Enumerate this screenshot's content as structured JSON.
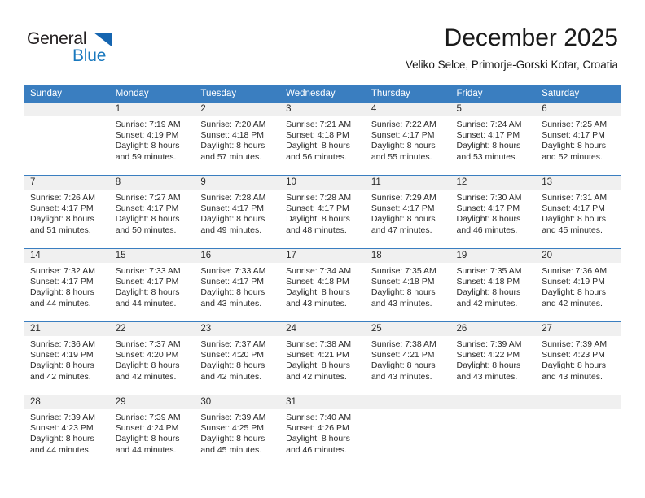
{
  "brand": {
    "name_top": "General",
    "name_bottom": "Blue",
    "accent_color": "#1878be",
    "triangle_color": "#1565b0"
  },
  "header": {
    "title": "December 2025",
    "subtitle": "Veliko Selce, Primorje-Gorski Kotar, Croatia"
  },
  "theme": {
    "header_row_bg": "#3a7ec0",
    "daynum_bg": "#f0f0f0",
    "text_color": "#2b2b2b"
  },
  "weekdays": [
    "Sunday",
    "Monday",
    "Tuesday",
    "Wednesday",
    "Thursday",
    "Friday",
    "Saturday"
  ],
  "weeks": [
    [
      {
        "day": "",
        "sunrise": "",
        "sunset": "",
        "daylight_l1": "",
        "daylight_l2": "",
        "empty": true
      },
      {
        "day": "1",
        "sunrise": "Sunrise: 7:19 AM",
        "sunset": "Sunset: 4:19 PM",
        "daylight_l1": "Daylight: 8 hours",
        "daylight_l2": "and 59 minutes."
      },
      {
        "day": "2",
        "sunrise": "Sunrise: 7:20 AM",
        "sunset": "Sunset: 4:18 PM",
        "daylight_l1": "Daylight: 8 hours",
        "daylight_l2": "and 57 minutes."
      },
      {
        "day": "3",
        "sunrise": "Sunrise: 7:21 AM",
        "sunset": "Sunset: 4:18 PM",
        "daylight_l1": "Daylight: 8 hours",
        "daylight_l2": "and 56 minutes."
      },
      {
        "day": "4",
        "sunrise": "Sunrise: 7:22 AM",
        "sunset": "Sunset: 4:17 PM",
        "daylight_l1": "Daylight: 8 hours",
        "daylight_l2": "and 55 minutes."
      },
      {
        "day": "5",
        "sunrise": "Sunrise: 7:24 AM",
        "sunset": "Sunset: 4:17 PM",
        "daylight_l1": "Daylight: 8 hours",
        "daylight_l2": "and 53 minutes."
      },
      {
        "day": "6",
        "sunrise": "Sunrise: 7:25 AM",
        "sunset": "Sunset: 4:17 PM",
        "daylight_l1": "Daylight: 8 hours",
        "daylight_l2": "and 52 minutes."
      }
    ],
    [
      {
        "day": "7",
        "sunrise": "Sunrise: 7:26 AM",
        "sunset": "Sunset: 4:17 PM",
        "daylight_l1": "Daylight: 8 hours",
        "daylight_l2": "and 51 minutes."
      },
      {
        "day": "8",
        "sunrise": "Sunrise: 7:27 AM",
        "sunset": "Sunset: 4:17 PM",
        "daylight_l1": "Daylight: 8 hours",
        "daylight_l2": "and 50 minutes."
      },
      {
        "day": "9",
        "sunrise": "Sunrise: 7:28 AM",
        "sunset": "Sunset: 4:17 PM",
        "daylight_l1": "Daylight: 8 hours",
        "daylight_l2": "and 49 minutes."
      },
      {
        "day": "10",
        "sunrise": "Sunrise: 7:28 AM",
        "sunset": "Sunset: 4:17 PM",
        "daylight_l1": "Daylight: 8 hours",
        "daylight_l2": "and 48 minutes."
      },
      {
        "day": "11",
        "sunrise": "Sunrise: 7:29 AM",
        "sunset": "Sunset: 4:17 PM",
        "daylight_l1": "Daylight: 8 hours",
        "daylight_l2": "and 47 minutes."
      },
      {
        "day": "12",
        "sunrise": "Sunrise: 7:30 AM",
        "sunset": "Sunset: 4:17 PM",
        "daylight_l1": "Daylight: 8 hours",
        "daylight_l2": "and 46 minutes."
      },
      {
        "day": "13",
        "sunrise": "Sunrise: 7:31 AM",
        "sunset": "Sunset: 4:17 PM",
        "daylight_l1": "Daylight: 8 hours",
        "daylight_l2": "and 45 minutes."
      }
    ],
    [
      {
        "day": "14",
        "sunrise": "Sunrise: 7:32 AM",
        "sunset": "Sunset: 4:17 PM",
        "daylight_l1": "Daylight: 8 hours",
        "daylight_l2": "and 44 minutes."
      },
      {
        "day": "15",
        "sunrise": "Sunrise: 7:33 AM",
        "sunset": "Sunset: 4:17 PM",
        "daylight_l1": "Daylight: 8 hours",
        "daylight_l2": "and 44 minutes."
      },
      {
        "day": "16",
        "sunrise": "Sunrise: 7:33 AM",
        "sunset": "Sunset: 4:17 PM",
        "daylight_l1": "Daylight: 8 hours",
        "daylight_l2": "and 43 minutes."
      },
      {
        "day": "17",
        "sunrise": "Sunrise: 7:34 AM",
        "sunset": "Sunset: 4:18 PM",
        "daylight_l1": "Daylight: 8 hours",
        "daylight_l2": "and 43 minutes."
      },
      {
        "day": "18",
        "sunrise": "Sunrise: 7:35 AM",
        "sunset": "Sunset: 4:18 PM",
        "daylight_l1": "Daylight: 8 hours",
        "daylight_l2": "and 43 minutes."
      },
      {
        "day": "19",
        "sunrise": "Sunrise: 7:35 AM",
        "sunset": "Sunset: 4:18 PM",
        "daylight_l1": "Daylight: 8 hours",
        "daylight_l2": "and 42 minutes."
      },
      {
        "day": "20",
        "sunrise": "Sunrise: 7:36 AM",
        "sunset": "Sunset: 4:19 PM",
        "daylight_l1": "Daylight: 8 hours",
        "daylight_l2": "and 42 minutes."
      }
    ],
    [
      {
        "day": "21",
        "sunrise": "Sunrise: 7:36 AM",
        "sunset": "Sunset: 4:19 PM",
        "daylight_l1": "Daylight: 8 hours",
        "daylight_l2": "and 42 minutes."
      },
      {
        "day": "22",
        "sunrise": "Sunrise: 7:37 AM",
        "sunset": "Sunset: 4:20 PM",
        "daylight_l1": "Daylight: 8 hours",
        "daylight_l2": "and 42 minutes."
      },
      {
        "day": "23",
        "sunrise": "Sunrise: 7:37 AM",
        "sunset": "Sunset: 4:20 PM",
        "daylight_l1": "Daylight: 8 hours",
        "daylight_l2": "and 42 minutes."
      },
      {
        "day": "24",
        "sunrise": "Sunrise: 7:38 AM",
        "sunset": "Sunset: 4:21 PM",
        "daylight_l1": "Daylight: 8 hours",
        "daylight_l2": "and 42 minutes."
      },
      {
        "day": "25",
        "sunrise": "Sunrise: 7:38 AM",
        "sunset": "Sunset: 4:21 PM",
        "daylight_l1": "Daylight: 8 hours",
        "daylight_l2": "and 43 minutes."
      },
      {
        "day": "26",
        "sunrise": "Sunrise: 7:39 AM",
        "sunset": "Sunset: 4:22 PM",
        "daylight_l1": "Daylight: 8 hours",
        "daylight_l2": "and 43 minutes."
      },
      {
        "day": "27",
        "sunrise": "Sunrise: 7:39 AM",
        "sunset": "Sunset: 4:23 PM",
        "daylight_l1": "Daylight: 8 hours",
        "daylight_l2": "and 43 minutes."
      }
    ],
    [
      {
        "day": "28",
        "sunrise": "Sunrise: 7:39 AM",
        "sunset": "Sunset: 4:23 PM",
        "daylight_l1": "Daylight: 8 hours",
        "daylight_l2": "and 44 minutes."
      },
      {
        "day": "29",
        "sunrise": "Sunrise: 7:39 AM",
        "sunset": "Sunset: 4:24 PM",
        "daylight_l1": "Daylight: 8 hours",
        "daylight_l2": "and 44 minutes."
      },
      {
        "day": "30",
        "sunrise": "Sunrise: 7:39 AM",
        "sunset": "Sunset: 4:25 PM",
        "daylight_l1": "Daylight: 8 hours",
        "daylight_l2": "and 45 minutes."
      },
      {
        "day": "31",
        "sunrise": "Sunrise: 7:40 AM",
        "sunset": "Sunset: 4:26 PM",
        "daylight_l1": "Daylight: 8 hours",
        "daylight_l2": "and 46 minutes."
      },
      {
        "day": "",
        "sunrise": "",
        "sunset": "",
        "daylight_l1": "",
        "daylight_l2": "",
        "empty": true
      },
      {
        "day": "",
        "sunrise": "",
        "sunset": "",
        "daylight_l1": "",
        "daylight_l2": "",
        "empty": true
      },
      {
        "day": "",
        "sunrise": "",
        "sunset": "",
        "daylight_l1": "",
        "daylight_l2": "",
        "empty": true
      }
    ]
  ]
}
